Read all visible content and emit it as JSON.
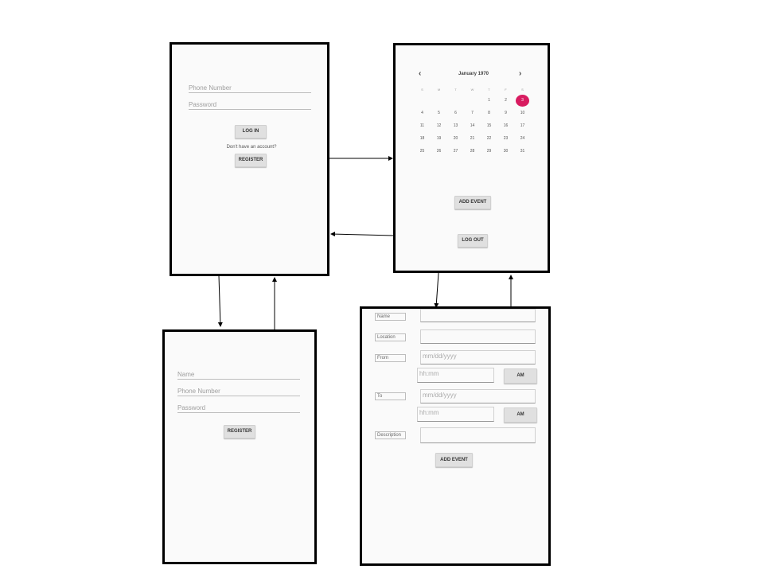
{
  "login": {
    "phone_placeholder": "Phone Number",
    "password_placeholder": "Password",
    "login_button": "LOG IN",
    "no_account_text": "Don't have an account?",
    "register_button": "REGISTER"
  },
  "calendar": {
    "month_title": "January 1970",
    "prev_icon": "chevron-left-icon",
    "next_icon": "chevron-right-icon",
    "weekdays": [
      "S",
      "M",
      "T",
      "W",
      "T",
      "F",
      "S"
    ],
    "days": [
      "",
      "",
      "",
      "",
      "1",
      "2",
      "3",
      "4",
      "5",
      "6",
      "7",
      "8",
      "9",
      "10",
      "11",
      "12",
      "13",
      "14",
      "15",
      "16",
      "17",
      "18",
      "19",
      "20",
      "21",
      "22",
      "23",
      "24",
      "25",
      "26",
      "27",
      "28",
      "29",
      "30",
      "31"
    ],
    "selected_day": "3",
    "selected_color": "#d81b60",
    "add_event_button": "ADD EVENT",
    "logout_button": "LOG OUT"
  },
  "register": {
    "name_placeholder": "Name",
    "phone_placeholder": "Phone Number",
    "password_placeholder": "Password",
    "register_button": "REGISTER"
  },
  "event": {
    "name_label": "Name",
    "location_label": "Location",
    "from_label": "From",
    "from_date_placeholder": "mm/dd/yyyy",
    "from_time_placeholder": "hh:mm",
    "from_ampm": "AM",
    "to_label": "To",
    "to_date_placeholder": "mm/dd/yyyy",
    "to_time_placeholder": "hh:mm",
    "to_ampm": "AM",
    "description_label": "Description",
    "add_event_button": "ADD EVENT"
  }
}
